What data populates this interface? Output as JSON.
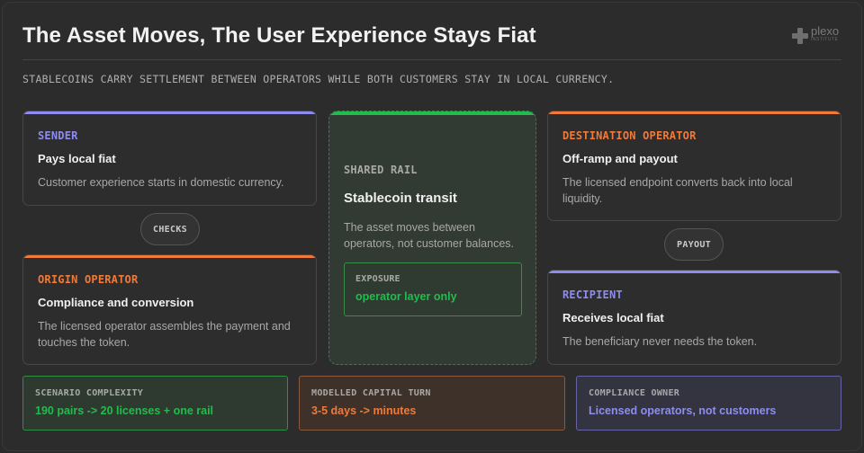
{
  "title": "The Asset Moves, The User Experience Stays Fiat",
  "subtitle": "STABLECOINS CARRY SETTLEMENT BETWEEN OPERATORS WHILE BOTH CUSTOMERS STAY IN LOCAL CURRENCY.",
  "logo": {
    "name": "plexo",
    "sub": "INSTITUTE"
  },
  "colors": {
    "purple": "#8f8cf0",
    "orange": "#f07a3a",
    "green": "#1fbd4b"
  },
  "sender": {
    "kicker": "SENDER",
    "heading": "Pays local fiat",
    "body": "Customer experience starts in domestic currency."
  },
  "checks_pill": "CHECKS",
  "origin": {
    "kicker": "ORIGIN OPERATOR",
    "heading": "Compliance and conversion",
    "body": "The licensed operator assembles the payment and touches the token."
  },
  "rail": {
    "kicker": "SHARED RAIL",
    "heading": "Stablecoin transit",
    "body": "The asset moves between operators, not customer balances.",
    "exposure_label": "EXPOSURE",
    "exposure_value": "operator layer only"
  },
  "destination": {
    "kicker": "DESTINATION OPERATOR",
    "heading": "Off-ramp and payout",
    "body": "The licensed endpoint converts back into local liquidity."
  },
  "payout_pill": "PAYOUT",
  "recipient": {
    "kicker": "RECIPIENT",
    "heading": "Receives local fiat",
    "body": "The beneficiary never needs the token."
  },
  "stats": [
    {
      "label": "SCENARIO COMPLEXITY",
      "value": "190 pairs -> 20 licenses + one rail"
    },
    {
      "label": "MODELLED CAPITAL TURN",
      "value": "3-5 days -> minutes"
    },
    {
      "label": "COMPLIANCE OWNER",
      "value": "Licensed operators, not customers"
    }
  ]
}
